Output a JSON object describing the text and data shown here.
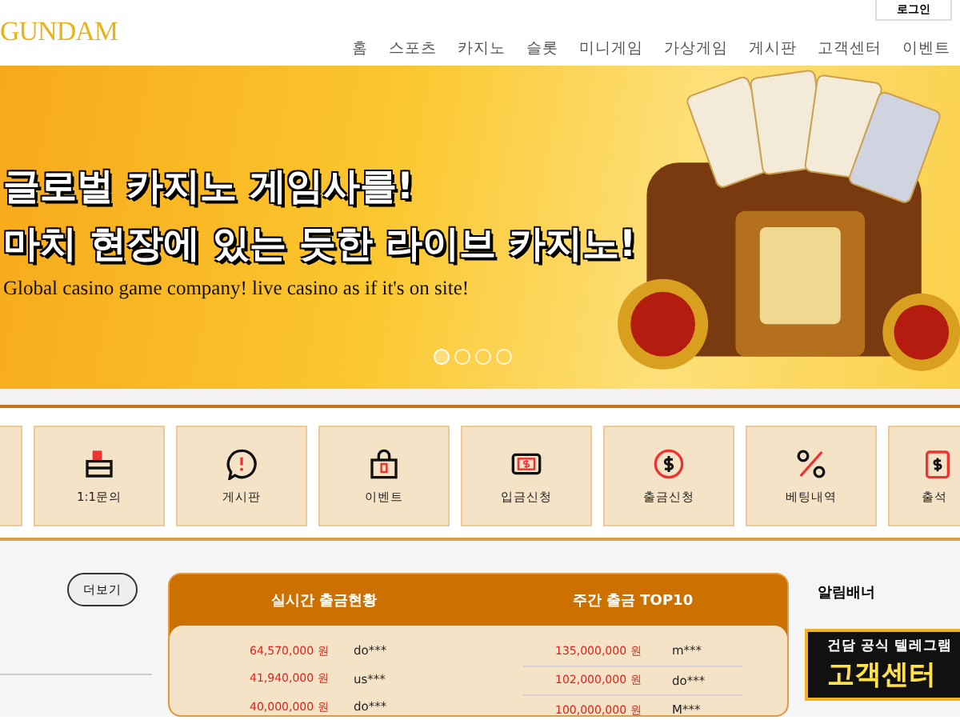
{
  "header": {
    "logo": "GUNDAM",
    "login_button": "로그인",
    "nav": [
      {
        "label": "홈"
      },
      {
        "label": "스포츠"
      },
      {
        "label": "카지노"
      },
      {
        "label": "슬롯"
      },
      {
        "label": "미니게임"
      },
      {
        "label": "가상게임"
      },
      {
        "label": "게시판"
      },
      {
        "label": "고객센터"
      },
      {
        "label": "이벤트"
      }
    ]
  },
  "banner": {
    "headline_lines": [
      "글로벌 카지노 게임사를!",
      "마치 현장에 있는 듯한 라이브 카지노!"
    ],
    "subtitle": "Global casino game company! live casino as if it's on site!",
    "slides": [
      {
        "selected": true
      },
      {
        "selected": false
      },
      {
        "selected": false
      },
      {
        "selected": false
      }
    ]
  },
  "quick_menu": [
    {
      "kind": "blank"
    },
    {
      "kind": "inbox",
      "label": "1:1문의"
    },
    {
      "kind": "chat",
      "label": "게시판"
    },
    {
      "kind": "gift",
      "label": "이벤트"
    },
    {
      "kind": "cash",
      "label": "입금신청"
    },
    {
      "kind": "coin",
      "label": "출금신청"
    },
    {
      "kind": "percent",
      "label": "베팅내역"
    },
    {
      "kind": "calendar",
      "label": "출석"
    }
  ],
  "more_button": "더보기",
  "withdrawals": {
    "live_title": "실시간 출금현황",
    "weekly_title": "주간 출금 TOP10",
    "live_rows": [
      {
        "amount": "64,570,000 원",
        "user": "do***"
      },
      {
        "amount": "41,940,000 원",
        "user": "us***"
      },
      {
        "amount": "40,000,000 원",
        "user": "do***"
      }
    ],
    "weekly_rows": [
      {
        "amount": "135,000,000 원",
        "user": "m***"
      },
      {
        "amount": "102,000,000 원",
        "user": "do***"
      },
      {
        "amount": "100,000,000 원",
        "user": "M***"
      }
    ]
  },
  "notice_banner": {
    "title": "알림배너",
    "banner_lines": [
      "건담 공식 텔레그램",
      "고객센터"
    ]
  }
}
